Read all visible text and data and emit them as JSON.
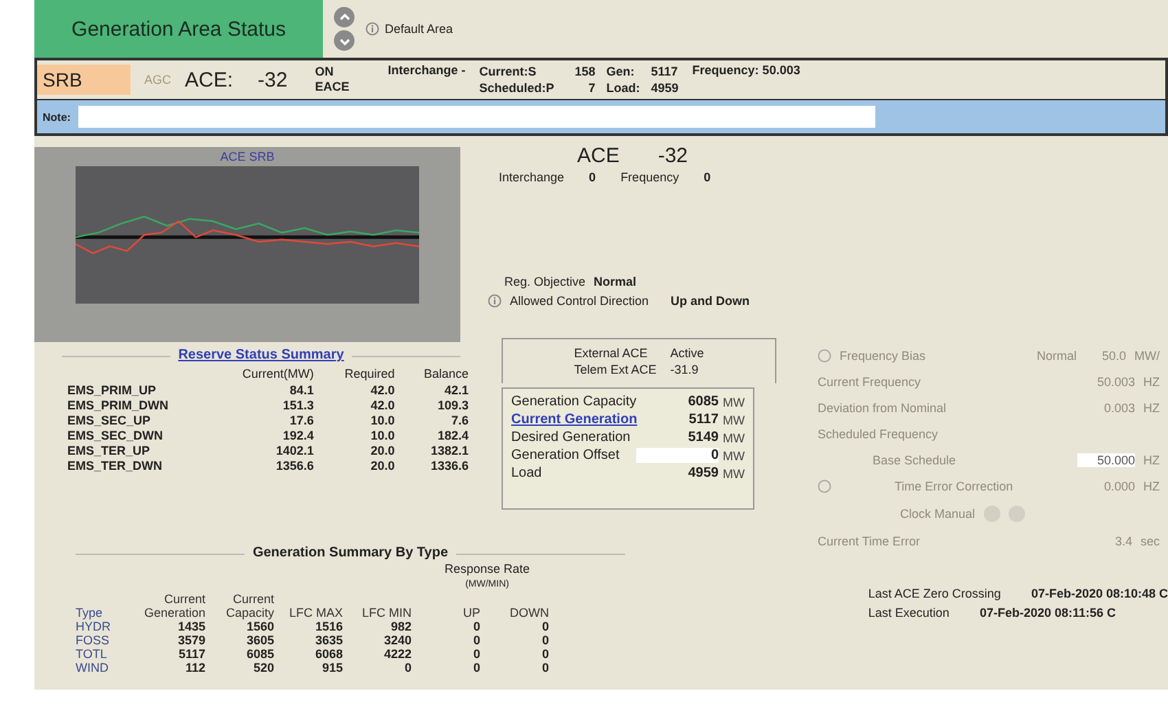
{
  "title": "Generation Area Status",
  "default_area": "Default Area",
  "area": {
    "code": "SRB",
    "agc": "AGC",
    "ace_label": "ACE:",
    "ace_value": "-32",
    "status": [
      "ON",
      "EACE"
    ],
    "interchange_label": "Interchange -",
    "current_label": "Current:S",
    "current_value": "158",
    "scheduled_label": "Scheduled:P",
    "scheduled_value": "7",
    "gen_label": "Gen:",
    "gen_value": "5117",
    "load_label": "Load:",
    "load_value": "4959",
    "frequency": "Frequency: 50.003"
  },
  "note": {
    "label": "Note:"
  },
  "chart": {
    "title": "ACE SRB"
  },
  "ace_summary": {
    "label": "ACE",
    "value": "-32",
    "interchange_label": "Interchange",
    "interchange_value": "0",
    "frequency_label": "Frequency",
    "frequency_value": "0"
  },
  "regulation": {
    "objective_label": "Reg. Objective",
    "objective": "Normal",
    "direction_label": "Allowed Control Direction",
    "direction": "Up and Down"
  },
  "external": {
    "label": "External ACE",
    "status": "Active",
    "telem_label": "Telem Ext ACE",
    "telem_value": "-31.9"
  },
  "generation": [
    {
      "kind": "text",
      "label": "Generation Capacity",
      "value": "6085",
      "unit": "MW"
    },
    {
      "kind": "link",
      "label": "Current Generation",
      "value": "5117",
      "unit": "MW"
    },
    {
      "kind": "text",
      "label": "Desired Generation",
      "value": "5149",
      "unit": "MW"
    },
    {
      "kind": "input",
      "label": "Generation Offset",
      "value": "0",
      "unit": "MW"
    },
    {
      "kind": "text",
      "label": "Load",
      "value": "4959",
      "unit": "MW"
    }
  ],
  "frequency_panel": {
    "disabled": true,
    "rows": [
      {
        "kind": "info",
        "label": "Frequency Bias",
        "value": "Normal",
        "extra": "50.0",
        "unit": "MW/"
      },
      {
        "kind": "text",
        "label": "Current Frequency",
        "value": "50.003",
        "unit": "HZ"
      },
      {
        "kind": "text",
        "label": "Deviation from Nominal",
        "value": "0.003",
        "unit": "HZ"
      },
      {
        "kind": "heading",
        "label": "Scheduled Frequency"
      },
      {
        "kind": "input",
        "label": "Base Schedule",
        "value": "50.000",
        "unit": "HZ"
      },
      {
        "kind": "info",
        "label": "Time Error Correction",
        "value": "0.000",
        "unit": "HZ"
      },
      {
        "kind": "buttons",
        "label": "Clock Manual"
      },
      {
        "kind": "text",
        "label": "Current Time Error",
        "value": "3.4",
        "unit": "sec"
      }
    ]
  },
  "reserve": {
    "title": "Reserve Status Summary",
    "columns": [
      "",
      "Current(MW)",
      "Required",
      "Balance"
    ],
    "rows": [
      [
        "EMS_PRIM_UP",
        "84.1",
        "42.0",
        "42.1"
      ],
      [
        "EMS_PRIM_DWN",
        "151.3",
        "42.0",
        "109.3"
      ],
      [
        "EMS_SEC_UP",
        "17.6",
        "10.0",
        "7.6"
      ],
      [
        "EMS_SEC_DWN",
        "192.4",
        "10.0",
        "182.4"
      ],
      [
        "EMS_TER_UP",
        "1402.1",
        "20.0",
        "1382.1"
      ],
      [
        "EMS_TER_DWN",
        "1356.6",
        "20.0",
        "1336.6"
      ]
    ]
  },
  "gen_summary": {
    "title": "Generation Summary By Type",
    "group_header": "Response Rate",
    "group_unit": "(MW/MIN)",
    "columns": [
      "Type",
      "Current Generation",
      "Current Capacity",
      "LFC MAX",
      "LFC MIN",
      "UP",
      "DOWN"
    ],
    "rows": [
      [
        "HYDR",
        "1435",
        "1560",
        "1516",
        "982",
        "0",
        "0"
      ],
      [
        "FOSS",
        "3579",
        "3605",
        "3635",
        "3240",
        "0",
        "0"
      ],
      [
        "TOTL",
        "5117",
        "6085",
        "6068",
        "4222",
        "0",
        "0"
      ],
      [
        "WIND",
        "112",
        "520",
        "915",
        "0",
        "0",
        "0"
      ]
    ]
  },
  "timestamps": [
    {
      "label": "Last ACE Zero Crossing",
      "value": "07-Feb-2020 08:10:48 C"
    },
    {
      "label": "Last Execution",
      "value": "07-Feb-2020 08:11:56 C"
    }
  ]
}
